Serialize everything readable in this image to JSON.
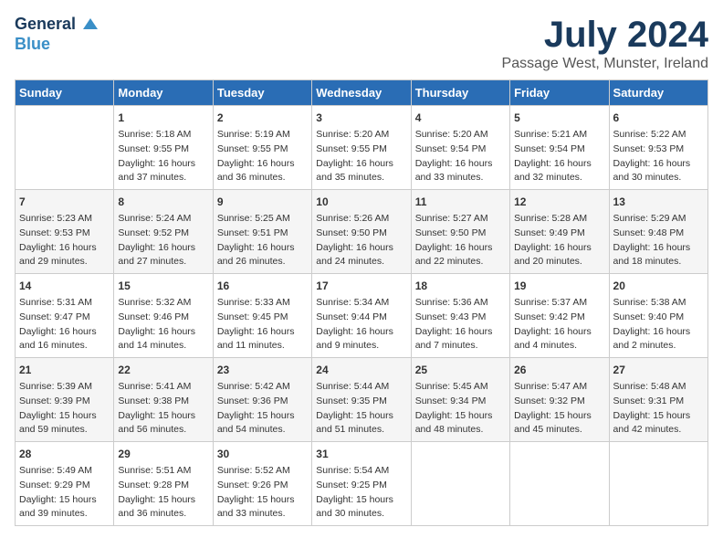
{
  "logo": {
    "general": "General",
    "blue": "Blue"
  },
  "title": "July 2024",
  "subtitle": "Passage West, Munster, Ireland",
  "days": [
    "Sunday",
    "Monday",
    "Tuesday",
    "Wednesday",
    "Thursday",
    "Friday",
    "Saturday"
  ],
  "weeks": [
    [
      {
        "num": "",
        "lines": []
      },
      {
        "num": "1",
        "lines": [
          "Sunrise: 5:18 AM",
          "Sunset: 9:55 PM",
          "Daylight: 16 hours",
          "and 37 minutes."
        ]
      },
      {
        "num": "2",
        "lines": [
          "Sunrise: 5:19 AM",
          "Sunset: 9:55 PM",
          "Daylight: 16 hours",
          "and 36 minutes."
        ]
      },
      {
        "num": "3",
        "lines": [
          "Sunrise: 5:20 AM",
          "Sunset: 9:55 PM",
          "Daylight: 16 hours",
          "and 35 minutes."
        ]
      },
      {
        "num": "4",
        "lines": [
          "Sunrise: 5:20 AM",
          "Sunset: 9:54 PM",
          "Daylight: 16 hours",
          "and 33 minutes."
        ]
      },
      {
        "num": "5",
        "lines": [
          "Sunrise: 5:21 AM",
          "Sunset: 9:54 PM",
          "Daylight: 16 hours",
          "and 32 minutes."
        ]
      },
      {
        "num": "6",
        "lines": [
          "Sunrise: 5:22 AM",
          "Sunset: 9:53 PM",
          "Daylight: 16 hours",
          "and 30 minutes."
        ]
      }
    ],
    [
      {
        "num": "7",
        "lines": [
          "Sunrise: 5:23 AM",
          "Sunset: 9:53 PM",
          "Daylight: 16 hours",
          "and 29 minutes."
        ]
      },
      {
        "num": "8",
        "lines": [
          "Sunrise: 5:24 AM",
          "Sunset: 9:52 PM",
          "Daylight: 16 hours",
          "and 27 minutes."
        ]
      },
      {
        "num": "9",
        "lines": [
          "Sunrise: 5:25 AM",
          "Sunset: 9:51 PM",
          "Daylight: 16 hours",
          "and 26 minutes."
        ]
      },
      {
        "num": "10",
        "lines": [
          "Sunrise: 5:26 AM",
          "Sunset: 9:50 PM",
          "Daylight: 16 hours",
          "and 24 minutes."
        ]
      },
      {
        "num": "11",
        "lines": [
          "Sunrise: 5:27 AM",
          "Sunset: 9:50 PM",
          "Daylight: 16 hours",
          "and 22 minutes."
        ]
      },
      {
        "num": "12",
        "lines": [
          "Sunrise: 5:28 AM",
          "Sunset: 9:49 PM",
          "Daylight: 16 hours",
          "and 20 minutes."
        ]
      },
      {
        "num": "13",
        "lines": [
          "Sunrise: 5:29 AM",
          "Sunset: 9:48 PM",
          "Daylight: 16 hours",
          "and 18 minutes."
        ]
      }
    ],
    [
      {
        "num": "14",
        "lines": [
          "Sunrise: 5:31 AM",
          "Sunset: 9:47 PM",
          "Daylight: 16 hours",
          "and 16 minutes."
        ]
      },
      {
        "num": "15",
        "lines": [
          "Sunrise: 5:32 AM",
          "Sunset: 9:46 PM",
          "Daylight: 16 hours",
          "and 14 minutes."
        ]
      },
      {
        "num": "16",
        "lines": [
          "Sunrise: 5:33 AM",
          "Sunset: 9:45 PM",
          "Daylight: 16 hours",
          "and 11 minutes."
        ]
      },
      {
        "num": "17",
        "lines": [
          "Sunrise: 5:34 AM",
          "Sunset: 9:44 PM",
          "Daylight: 16 hours",
          "and 9 minutes."
        ]
      },
      {
        "num": "18",
        "lines": [
          "Sunrise: 5:36 AM",
          "Sunset: 9:43 PM",
          "Daylight: 16 hours",
          "and 7 minutes."
        ]
      },
      {
        "num": "19",
        "lines": [
          "Sunrise: 5:37 AM",
          "Sunset: 9:42 PM",
          "Daylight: 16 hours",
          "and 4 minutes."
        ]
      },
      {
        "num": "20",
        "lines": [
          "Sunrise: 5:38 AM",
          "Sunset: 9:40 PM",
          "Daylight: 16 hours",
          "and 2 minutes."
        ]
      }
    ],
    [
      {
        "num": "21",
        "lines": [
          "Sunrise: 5:39 AM",
          "Sunset: 9:39 PM",
          "Daylight: 15 hours",
          "and 59 minutes."
        ]
      },
      {
        "num": "22",
        "lines": [
          "Sunrise: 5:41 AM",
          "Sunset: 9:38 PM",
          "Daylight: 15 hours",
          "and 56 minutes."
        ]
      },
      {
        "num": "23",
        "lines": [
          "Sunrise: 5:42 AM",
          "Sunset: 9:36 PM",
          "Daylight: 15 hours",
          "and 54 minutes."
        ]
      },
      {
        "num": "24",
        "lines": [
          "Sunrise: 5:44 AM",
          "Sunset: 9:35 PM",
          "Daylight: 15 hours",
          "and 51 minutes."
        ]
      },
      {
        "num": "25",
        "lines": [
          "Sunrise: 5:45 AM",
          "Sunset: 9:34 PM",
          "Daylight: 15 hours",
          "and 48 minutes."
        ]
      },
      {
        "num": "26",
        "lines": [
          "Sunrise: 5:47 AM",
          "Sunset: 9:32 PM",
          "Daylight: 15 hours",
          "and 45 minutes."
        ]
      },
      {
        "num": "27",
        "lines": [
          "Sunrise: 5:48 AM",
          "Sunset: 9:31 PM",
          "Daylight: 15 hours",
          "and 42 minutes."
        ]
      }
    ],
    [
      {
        "num": "28",
        "lines": [
          "Sunrise: 5:49 AM",
          "Sunset: 9:29 PM",
          "Daylight: 15 hours",
          "and 39 minutes."
        ]
      },
      {
        "num": "29",
        "lines": [
          "Sunrise: 5:51 AM",
          "Sunset: 9:28 PM",
          "Daylight: 15 hours",
          "and 36 minutes."
        ]
      },
      {
        "num": "30",
        "lines": [
          "Sunrise: 5:52 AM",
          "Sunset: 9:26 PM",
          "Daylight: 15 hours",
          "and 33 minutes."
        ]
      },
      {
        "num": "31",
        "lines": [
          "Sunrise: 5:54 AM",
          "Sunset: 9:25 PM",
          "Daylight: 15 hours",
          "and 30 minutes."
        ]
      },
      {
        "num": "",
        "lines": []
      },
      {
        "num": "",
        "lines": []
      },
      {
        "num": "",
        "lines": []
      }
    ]
  ]
}
